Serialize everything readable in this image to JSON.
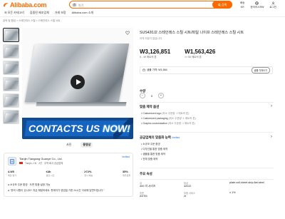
{
  "header": {
    "logo": "Alibaba.com",
    "nav": [
      "☰ 모든 카테고리",
      "집중된 제조업체",
      "거래 보장",
      "Alibaba.com 소개"
    ],
    "search_placeholder": "발견",
    "search_button": "검색",
    "right": {
      "deliver_label": "배송",
      "deliver_value": "KR",
      "lang_label": "한국어-KRW",
      "account_label": "로그인"
    }
  },
  "breadcrumb": "금속 및 합금  >  스테인리스 스틸  >  스테인리스 스틸 시트",
  "gallery": {
    "thumb_count": 6,
    "banner_text_1": "CONTACTS US ",
    "banner_text_2": "NOW!",
    "view_tabs": [
      "사진",
      "동영상"
    ]
  },
  "supplier": {
    "name": "Tianjin Tiangang Guanye Co., Ltd.",
    "country": "Tianjin, CN",
    "years": "2년",
    "type": "무역 회사 공급업체",
    "verified": "Verified",
    "stats": [
      {
        "value": "4.9/5",
        "label": "매장 평가"
      },
      {
        "value": "≤4h",
        "label": "응답 시간"
      },
      {
        "value": "≥72%",
        "label": "정시 배송"
      },
      {
        "value": "35%",
        "label": "재주문율"
      }
    ],
    "line1": "● 소규모 주문 환영 · 도면 맞춤 설정 가능",
    "line2": "● \"문의 사항이 있나요? 지금 채팅하세요. 판매자가 영업일 기준 24시간 이내에 답변드립니다.\""
  },
  "product": {
    "title": "SUS420J2 스테인레스 스틸 시트/파일 나이프 스테인레스 스틸 시트",
    "subtitle": "아직 리뷰가 없습니다",
    "prices": [
      {
        "price": "W3,126,851",
        "moq": "5 - 49 메트릭 톤"
      },
      {
        "price": "W1,563,426",
        "moq": ">= 50 메트릭 톤"
      }
    ],
    "sample_label": "샘플 가격: W1,564",
    "sample_button": "샘플 가져오기",
    "quantity_label": "수량",
    "quantity_value": "0",
    "custom_title": "맞춤 제작 옵션",
    "custom_items": [
      {
        "name": "Customized logo",
        "note": "(최소 주문량: 1 메트릭 톤)"
      },
      {
        "name": "Customized packaging",
        "note": "(최소 주문량: 1 메트릭 톤)"
      },
      {
        "name": "Graphic customization",
        "note": "(최소 주문량: 1 메트릭 톤)"
      }
    ],
    "protect_title": "공급업체의 맞춤화 능력",
    "protect_badge": "Verified",
    "protect_items": [
      "• 소규모 주문 환영",
      "• 디자인을 통한 맞춤 제작",
      "• 샘플을 통한 맞춤 제작",
      "• 전체 맞춤 제작"
    ],
    "attr_title": "주요 속성",
    "attributes": [
      {
        "k1": "급",
        "v1": "400 의 시리즈",
        "k2": "등급",
        "v2": "420J2",
        "k3": "",
        "v3": "plate,coil,sheet,strip,flat steel"
      },
      {
        "k1": "표준",
        "v1": "ASTM",
        "k2": "보증 서비스",
        "v2": "2t",
        "k3": "",
        "v3": "± 1%"
      }
    ]
  }
}
